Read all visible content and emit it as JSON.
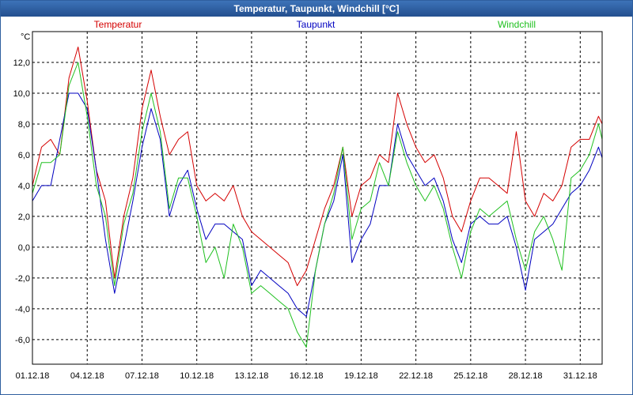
{
  "window": {
    "title": "Temperatur, Taupunkt, Windchill [°C]"
  },
  "chart_data": {
    "type": "line",
    "unit_label": "°C",
    "xlabel": "",
    "ylabel": "°C",
    "ylim": [
      -7.6,
      14.0
    ],
    "grid": true,
    "legend_placement": "top",
    "y_ticks": [
      -6,
      -4,
      -2,
      0,
      2,
      4,
      6,
      8,
      10,
      12
    ],
    "y_tick_labels": [
      "-6,0",
      "-4,0",
      "-2,0",
      "0,0",
      "2,0",
      "4,0",
      "6,0",
      "8,0",
      "10,0",
      "12,0"
    ],
    "x_range": [
      1,
      32.2
    ],
    "x_ticks": [
      1,
      4,
      7,
      10,
      13,
      16,
      19,
      22,
      25,
      28,
      31
    ],
    "x_tick_labels": [
      "01.12.18",
      "04.12.18",
      "07.12.18",
      "10.12.18",
      "13.12.18",
      "16.12.18",
      "19.12.18",
      "22.12.18",
      "25.12.18",
      "28.12.18",
      "31.12.18"
    ],
    "series": [
      {
        "name": "Temperatur",
        "color": "#d40000",
        "x": [
          1,
          1.5,
          2,
          2.5,
          3,
          3.5,
          4,
          4.5,
          5,
          5.5,
          6,
          6.5,
          7,
          7.5,
          8,
          8.5,
          9,
          9.5,
          10,
          10.5,
          11,
          11.5,
          12,
          12.5,
          13,
          13.5,
          14,
          14.5,
          15,
          15.5,
          16,
          16.5,
          17,
          17.5,
          18,
          18.5,
          19,
          19.5,
          20,
          20.5,
          21,
          21.5,
          22,
          22.5,
          23,
          23.5,
          24,
          24.5,
          25,
          25.5,
          26,
          26.5,
          27,
          27.5,
          28,
          28.5,
          29,
          29.5,
          30,
          30.5,
          31,
          31.5,
          32,
          32.2
        ],
        "values": [
          4.0,
          6.5,
          7.0,
          6.0,
          11.0,
          13.0,
          9.5,
          5.0,
          3.0,
          -2.0,
          2.0,
          4.5,
          9.0,
          11.5,
          8.5,
          6.0,
          7.0,
          7.5,
          4.0,
          3.0,
          3.5,
          3.0,
          4.0,
          2.0,
          1.0,
          0.5,
          0.0,
          -0.5,
          -1.0,
          -2.5,
          -1.5,
          0.5,
          2.5,
          4.0,
          6.5,
          2.0,
          4.0,
          4.5,
          6.0,
          5.5,
          10.0,
          8.0,
          6.5,
          5.5,
          6.0,
          4.5,
          2.0,
          1.0,
          3.0,
          4.5,
          4.5,
          4.0,
          3.5,
          7.5,
          3.0,
          2.0,
          3.5,
          3.0,
          4.0,
          6.5,
          7.0,
          7.0,
          8.5,
          8.0
        ]
      },
      {
        "name": "Taupunkt",
        "color": "#0000c0",
        "x": [
          1,
          1.5,
          2,
          2.5,
          3,
          3.5,
          4,
          4.5,
          5,
          5.5,
          6,
          6.5,
          7,
          7.5,
          8,
          8.5,
          9,
          9.5,
          10,
          10.5,
          11,
          11.5,
          12,
          12.5,
          13,
          13.5,
          14,
          14.5,
          15,
          15.5,
          16,
          16.5,
          17,
          17.5,
          18,
          18.5,
          19,
          19.5,
          20,
          20.5,
          21,
          21.5,
          22,
          22.5,
          23,
          23.5,
          24,
          24.5,
          25,
          25.5,
          26,
          26.5,
          27,
          27.5,
          28,
          28.5,
          29,
          29.5,
          30,
          30.5,
          31,
          31.5,
          32,
          32.2
        ],
        "values": [
          3.0,
          4.0,
          4.0,
          7.0,
          10.0,
          10.0,
          9.0,
          5.0,
          0.5,
          -3.0,
          0.0,
          3.0,
          6.5,
          9.0,
          7.0,
          2.0,
          4.0,
          5.0,
          2.5,
          0.5,
          1.5,
          1.5,
          1.0,
          0.5,
          -2.5,
          -1.5,
          -2.0,
          -2.5,
          -3.0,
          -4.0,
          -4.5,
          -1.5,
          1.5,
          3.0,
          6.0,
          -1.0,
          0.5,
          1.5,
          4.0,
          4.0,
          8.0,
          6.0,
          5.0,
          4.0,
          4.5,
          3.0,
          0.5,
          -1.0,
          1.5,
          2.0,
          1.5,
          1.5,
          2.0,
          0.0,
          -2.8,
          0.5,
          1.0,
          1.5,
          2.5,
          3.5,
          4.0,
          5.0,
          6.5,
          5.8
        ]
      },
      {
        "name": "Windchill",
        "color": "#20c020",
        "x": [
          1,
          1.5,
          2,
          2.5,
          3,
          3.5,
          4,
          4.5,
          5,
          5.5,
          6,
          6.5,
          7,
          7.5,
          8,
          8.5,
          9,
          9.5,
          10,
          10.5,
          11,
          11.5,
          12,
          12.5,
          13,
          13.5,
          14,
          14.5,
          15,
          15.5,
          16,
          16.5,
          17,
          17.5,
          18,
          18.5,
          19,
          19.5,
          20,
          20.5,
          21,
          21.5,
          22,
          22.5,
          23,
          23.5,
          24,
          24.5,
          25,
          25.5,
          26,
          26.5,
          27,
          27.5,
          28,
          28.5,
          29,
          29.5,
          30,
          30.5,
          31,
          31.5,
          32,
          32.2
        ],
        "values": [
          3.5,
          5.5,
          5.5,
          6.0,
          10.5,
          12.0,
          8.5,
          4.0,
          2.0,
          -2.5,
          1.5,
          3.5,
          7.5,
          10.0,
          7.5,
          2.5,
          4.5,
          4.5,
          2.0,
          -1.0,
          0.0,
          -2.0,
          1.5,
          0.0,
          -3.0,
          -2.5,
          -3.0,
          -3.5,
          -4.0,
          -5.5,
          -6.5,
          -1.5,
          1.5,
          3.5,
          6.5,
          0.5,
          2.5,
          3.0,
          5.5,
          4.0,
          7.5,
          5.5,
          4.0,
          3.0,
          4.0,
          2.5,
          0.0,
          -2.0,
          1.0,
          2.5,
          2.0,
          2.5,
          3.0,
          0.5,
          -1.5,
          1.0,
          2.0,
          0.5,
          -1.5,
          4.5,
          5.0,
          6.0,
          8.0,
          7.0
        ]
      }
    ]
  }
}
